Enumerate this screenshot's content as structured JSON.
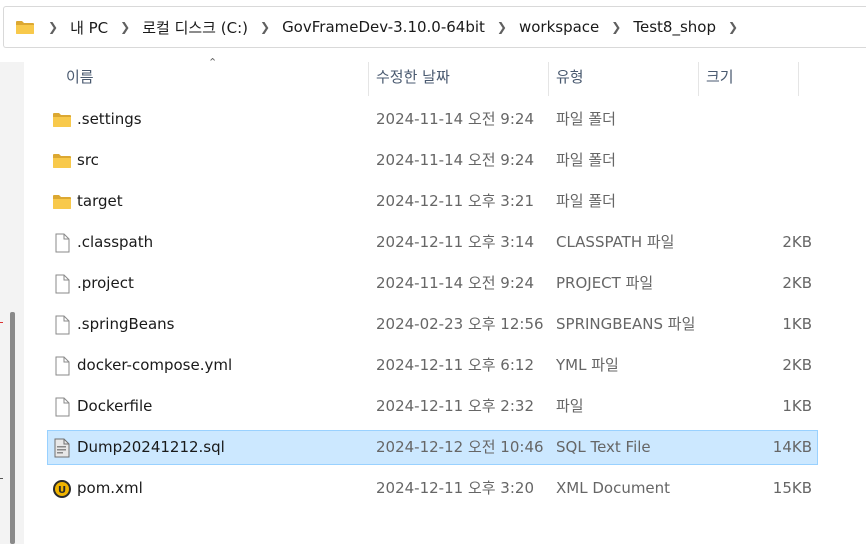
{
  "address_bar": {
    "crumbs": [
      "내 PC",
      "로컬 디스크 (C:)",
      "GovFrameDev-3.10.0-64bit",
      "workspace",
      "Test8_shop"
    ]
  },
  "columns": {
    "name": "이름",
    "date": "수정한 날짜",
    "type": "유형",
    "size": "크기"
  },
  "files": [
    {
      "name": ".settings",
      "date": "2024-11-14 오전 9:24",
      "type": "파일 폴더",
      "size": "",
      "icon": "folder-icon"
    },
    {
      "name": "src",
      "date": "2024-11-14 오전 9:24",
      "type": "파일 폴더",
      "size": "",
      "icon": "folder-icon"
    },
    {
      "name": "target",
      "date": "2024-12-11 오후 3:21",
      "type": "파일 폴더",
      "size": "",
      "icon": "folder-icon"
    },
    {
      "name": ".classpath",
      "date": "2024-12-11 오후 3:14",
      "type": "CLASSPATH 파일",
      "size": "2KB",
      "icon": "file-icon"
    },
    {
      "name": ".project",
      "date": "2024-11-14 오전 9:24",
      "type": "PROJECT 파일",
      "size": "2KB",
      "icon": "file-icon"
    },
    {
      "name": ".springBeans",
      "date": "2024-02-23 오후 12:56",
      "type": "SPRINGBEANS 파일",
      "size": "1KB",
      "icon": "file-icon"
    },
    {
      "name": "docker-compose.yml",
      "date": "2024-12-11 오후 6:12",
      "type": "YML 파일",
      "size": "2KB",
      "icon": "file-icon"
    },
    {
      "name": "Dockerfile",
      "date": "2024-12-11 오후 2:32",
      "type": "파일",
      "size": "1KB",
      "icon": "file-icon"
    },
    {
      "name": "Dump20241212.sql",
      "date": "2024-12-12 오전 10:46",
      "type": "SQL Text File",
      "size": "14KB",
      "icon": "sql-file-icon",
      "selected": true
    },
    {
      "name": "pom.xml",
      "date": "2024-12-11 오후 3:20",
      "type": "XML Document",
      "size": "15KB",
      "icon": "xml-editor-icon"
    }
  ],
  "colors": {
    "selection_bg": "#cce8ff",
    "selection_border": "#99d1ff",
    "folder": "#f8c94b"
  }
}
